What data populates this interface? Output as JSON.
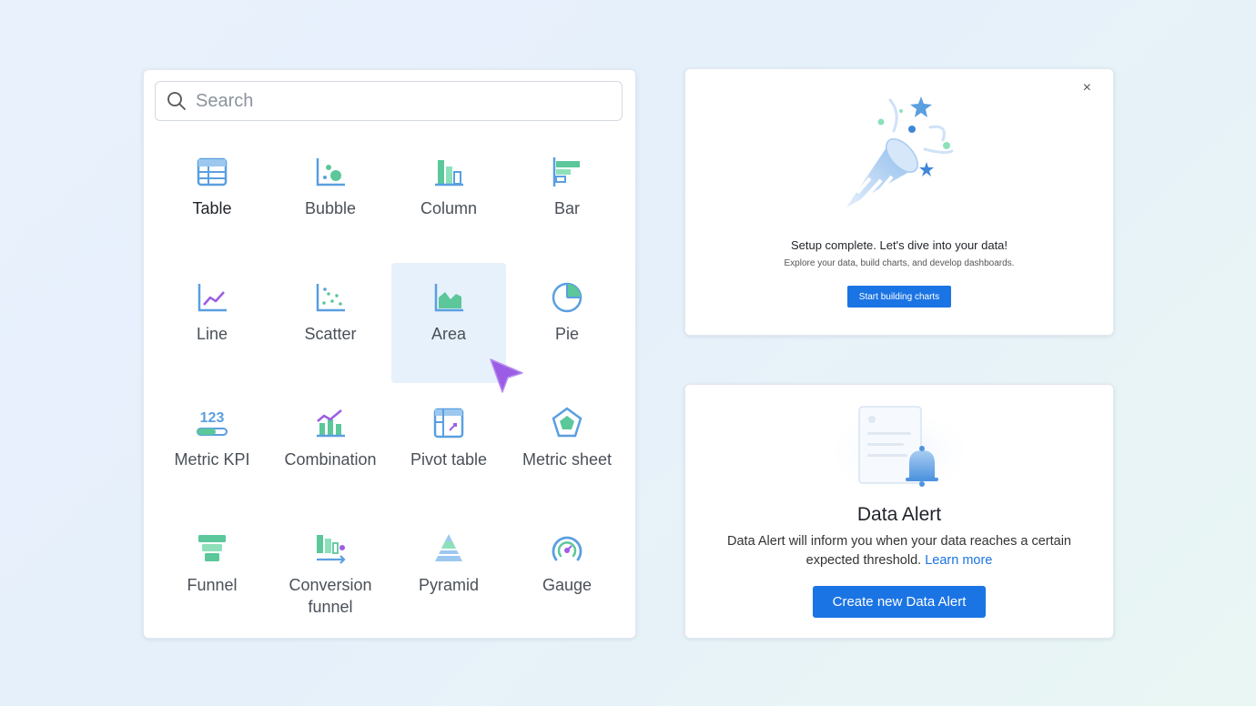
{
  "picker": {
    "search_placeholder": "Search",
    "items": [
      {
        "label": "Table"
      },
      {
        "label": "Bubble"
      },
      {
        "label": "Column"
      },
      {
        "label": "Bar"
      },
      {
        "label": "Line"
      },
      {
        "label": "Scatter"
      },
      {
        "label": "Area"
      },
      {
        "label": "Pie"
      },
      {
        "label": "Metric KPI"
      },
      {
        "label": "Combination"
      },
      {
        "label": "Pivot table"
      },
      {
        "label": "Metric sheet"
      },
      {
        "label": "Funnel"
      },
      {
        "label": "Conversion funnel"
      },
      {
        "label": "Pyramid"
      },
      {
        "label": "Gauge"
      }
    ],
    "selected": "Area",
    "kpi_icon_text": "123"
  },
  "setup": {
    "close_glyph": "×",
    "title": "Setup complete. Let's dive into your data!",
    "subtitle": "Explore your data, build charts, and develop dashboards.",
    "button": "Start building charts"
  },
  "alert": {
    "title": "Data Alert",
    "description": "Data Alert will inform you when your data reaches a certain expected threshold.",
    "link": "Learn more",
    "button": "Create new Data Alert"
  },
  "colors": {
    "blue": "#5a9fe0",
    "green": "#5bc79a",
    "purple": "#9b5de5",
    "button": "#1b74e4",
    "selected_bg": "#e7f1fb"
  }
}
